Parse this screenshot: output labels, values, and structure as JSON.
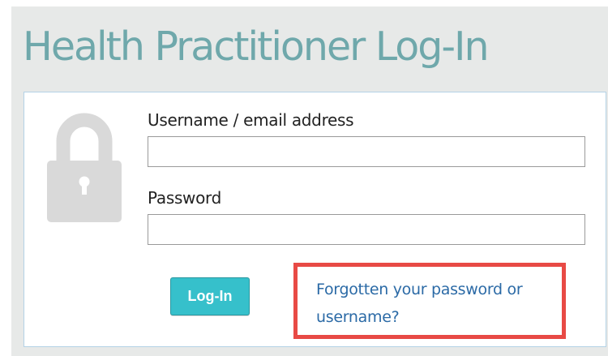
{
  "page": {
    "title": "Health Practitioner Log-In"
  },
  "form": {
    "username_label": "Username / email address",
    "username_value": "",
    "password_label": "Password",
    "password_value": "",
    "login_button_label": "Log-In",
    "forgot_link_text": "Forgotten your password or username?"
  },
  "icons": {
    "lock": "lock-icon"
  },
  "colors": {
    "title": "#6fa8ab",
    "button": "#36c0cb",
    "link": "#2b6aa6",
    "highlight": "#e84a45",
    "panel_background": "#e7e9e8",
    "icon": "#d9d9d9"
  }
}
